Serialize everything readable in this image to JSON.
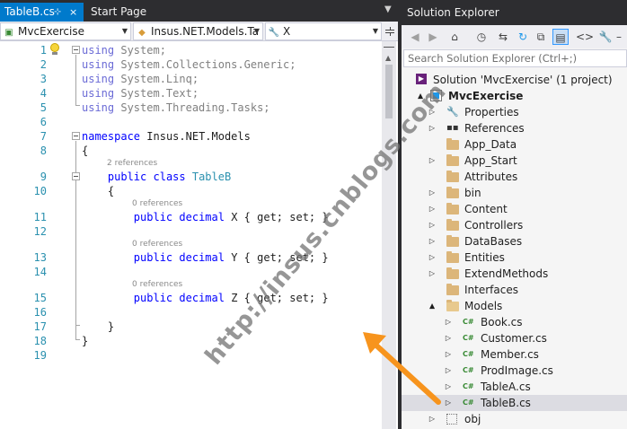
{
  "editor": {
    "tabs": [
      {
        "label": "TableB.cs",
        "pin": "⊹",
        "close": "×",
        "active": true
      },
      {
        "label": "Start Page",
        "active": false
      }
    ],
    "nav": {
      "project": "MvcExercise",
      "type": "Insus.NET.Models.Ta",
      "member": "X"
    },
    "line_numbers": [
      "1",
      "2",
      "3",
      "4",
      "5",
      "6",
      "7",
      "8",
      "9",
      "10",
      "11",
      "12",
      "13",
      "14",
      "15",
      "16",
      "17",
      "18",
      "19"
    ],
    "code": {
      "using_kw": "using",
      "usings": [
        "System;",
        "System.Collections.Generic;",
        "System.Linq;",
        "System.Text;",
        "System.Threading.Tasks;"
      ],
      "namespace_kw": "namespace",
      "namespace_name": "Insus.NET.Models",
      "open_brace": "{",
      "close_brace": "}",
      "class_refs": "2 references",
      "public_kw": "public",
      "class_kw": "class",
      "class_name": "TableB",
      "prop_refs": "0 references",
      "decimal_kw": "decimal",
      "props": [
        {
          "name": "X",
          "accessors": "{ get; set; }"
        },
        {
          "name": "Y",
          "accessors": "{ get; set; }"
        },
        {
          "name": "Z",
          "accessors": "{ get; set; }"
        }
      ]
    }
  },
  "solution_explorer": {
    "title": "Solution Explorer",
    "search_placeholder": "Search Solution Explorer (Ctrl+;)",
    "toolbar": [
      "back-icon",
      "forward-icon",
      "home-icon",
      "history-icon",
      "sync-icon",
      "refresh-icon",
      "collapse-all-icon",
      "show-all-files-icon",
      "view-code-icon",
      "properties-wrench-icon"
    ],
    "tree": [
      {
        "label": "Solution 'MvcExercise' (1 project)",
        "icon": "solution-icon",
        "level": 0,
        "expander": ""
      },
      {
        "label": "MvcExercise",
        "icon": "project-icon",
        "level": 1,
        "expander": "▲",
        "bold": true
      },
      {
        "label": "Properties",
        "icon": "wrench-icon",
        "level": 2,
        "expander": "▷"
      },
      {
        "label": "References",
        "icon": "references-icon",
        "level": 2,
        "expander": "▷"
      },
      {
        "label": "App_Data",
        "icon": "folder-icon",
        "level": 2,
        "expander": ""
      },
      {
        "label": "App_Start",
        "icon": "folder-icon",
        "level": 2,
        "expander": "▷"
      },
      {
        "label": "Attributes",
        "icon": "folder-icon",
        "level": 2,
        "expander": ""
      },
      {
        "label": "bin",
        "icon": "folder-icon",
        "level": 2,
        "expander": "▷"
      },
      {
        "label": "Content",
        "icon": "folder-icon",
        "level": 2,
        "expander": "▷"
      },
      {
        "label": "Controllers",
        "icon": "folder-icon",
        "level": 2,
        "expander": "▷"
      },
      {
        "label": "DataBases",
        "icon": "folder-icon",
        "level": 2,
        "expander": "▷"
      },
      {
        "label": "Entities",
        "icon": "folder-icon",
        "level": 2,
        "expander": "▷"
      },
      {
        "label": "ExtendMethods",
        "icon": "folder-icon",
        "level": 2,
        "expander": "▷"
      },
      {
        "label": "Interfaces",
        "icon": "folder-icon",
        "level": 2,
        "expander": ""
      },
      {
        "label": "Models",
        "icon": "folder-icon",
        "level": 2,
        "expander": "▲"
      },
      {
        "label": "Book.cs",
        "icon": "csharp-file-icon",
        "level": 3,
        "expander": "▷"
      },
      {
        "label": "Customer.cs",
        "icon": "csharp-file-icon",
        "level": 3,
        "expander": "▷"
      },
      {
        "label": "Member.cs",
        "icon": "csharp-file-icon",
        "level": 3,
        "expander": "▷"
      },
      {
        "label": "ProdImage.cs",
        "icon": "csharp-file-icon",
        "level": 3,
        "expander": "▷"
      },
      {
        "label": "TableA.cs",
        "icon": "csharp-file-icon",
        "level": 3,
        "expander": "▷"
      },
      {
        "label": "TableB.cs",
        "icon": "csharp-file-icon",
        "level": 3,
        "expander": "▷",
        "selected": true
      },
      {
        "label": "obj",
        "icon": "hidden-folder-icon",
        "level": 2,
        "expander": "▷"
      }
    ],
    "csharp_glyph": "C#"
  },
  "watermark": "http://insus.cnblogs.com",
  "colors": {
    "accent": "#007acc",
    "keyword": "#0000ff",
    "type": "#2b91af",
    "arrow": "#f7941d",
    "selection": "#dcdce2"
  }
}
